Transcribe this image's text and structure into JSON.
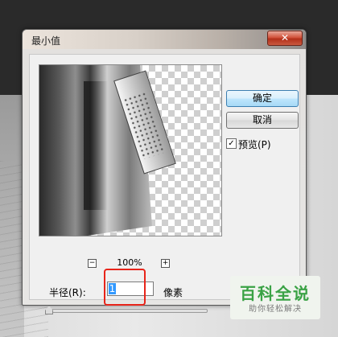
{
  "dialog": {
    "title": "最小值",
    "close_label": "✕"
  },
  "preview": {
    "zoom_minus": "−",
    "zoom_plus": "+",
    "zoom_level": "100%"
  },
  "radius": {
    "label": "半径(R):",
    "value": "1",
    "unit": "像素",
    "slider_fraction": 0.0
  },
  "buttons": {
    "ok_label": "确定",
    "cancel_label": "取消"
  },
  "options": {
    "preview_label": "预览(P)",
    "preview_checked": true,
    "check_glyph": "✓"
  },
  "watermark": {
    "main": "百科全说",
    "sub": "助你轻松解决"
  },
  "colors": {
    "highlight_box": "#e8241a",
    "watermark_green": "#3aa245"
  }
}
